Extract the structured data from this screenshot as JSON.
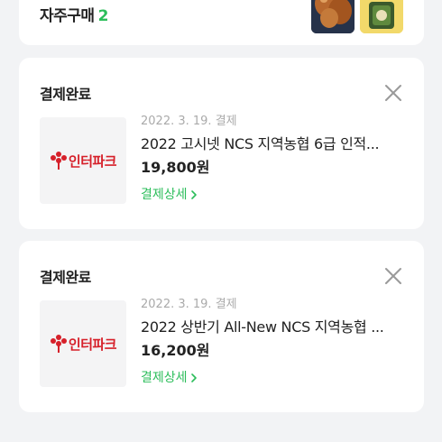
{
  "frequent": {
    "label": "자주구매",
    "count": "2"
  },
  "orders": [
    {
      "status": "결제완료",
      "date": "2022. 3. 19. 결제",
      "title": "2022 고시넷 NCS 지역농협 6급 인적...",
      "price": "19,800원",
      "detail_label": "결제상세",
      "brand": "인터파크"
    },
    {
      "status": "결제완료",
      "date": "2022. 3. 19. 결제",
      "title": "2022 상반기 All-New NCS 지역농협 ...",
      "price": "16,200원",
      "detail_label": "결제상세",
      "brand": "인터파크"
    }
  ],
  "colors": {
    "accent": "#2bbd5a",
    "brand": "#d6202a",
    "background": "#f2f3f5"
  },
  "icons": {
    "close": "close-icon",
    "chevron": "chevron-right-icon",
    "brand_logo": "interpark-logo-icon"
  }
}
